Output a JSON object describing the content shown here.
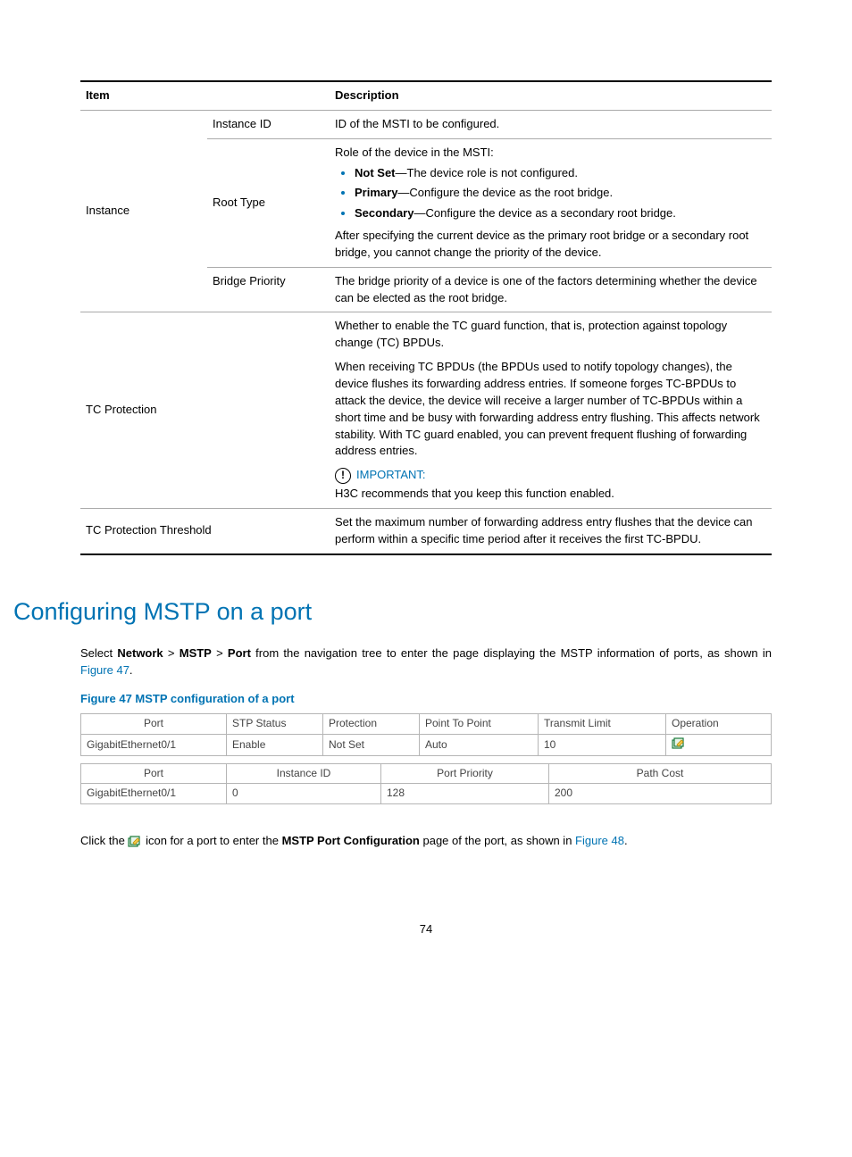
{
  "table": {
    "head_item": "Item",
    "head_desc": "Description",
    "instance_label": "Instance",
    "instance_id_label": "Instance ID",
    "instance_id_desc": "ID of the MSTI to be configured.",
    "root_type_label": "Root Type",
    "root_type_intro": "Role of the device in the MSTI:",
    "root_type_notset_b": "Not Set",
    "root_type_notset": "—The device role is not configured.",
    "root_type_primary_b": "Primary",
    "root_type_primary": "—Configure the device as the root bridge.",
    "root_type_secondary_b": "Secondary",
    "root_type_secondary": "—Configure the device as a secondary root bridge.",
    "root_type_after": "After specifying the current device as the primary root bridge or a secondary root bridge, you cannot change the priority of the device.",
    "bridge_priority_label": "Bridge Priority",
    "bridge_priority_desc": "The bridge priority of a device is one of the factors determining whether the device can be elected as the root bridge.",
    "tc_protection_label": "TC Protection",
    "tc_protection_p1": "Whether to enable the TC guard function, that is, protection against topology change (TC) BPDUs.",
    "tc_protection_p2": "When receiving TC BPDUs (the BPDUs used to notify topology changes), the device flushes its forwarding address entries. If someone forges TC-BPDUs to attack the device, the device will receive a larger number of TC-BPDUs within a short time and be busy with forwarding address entry flushing. This affects network stability. With TC guard enabled, you can prevent frequent flushing of forwarding address entries.",
    "important_label": "IMPORTANT:",
    "tc_protection_p3": "H3C recommends that you keep this function enabled.",
    "tc_threshold_label": "TC Protection Threshold",
    "tc_threshold_desc": "Set the maximum number of forwarding address entry flushes that the device can perform within a specific time period after it receives the first TC-BPDU."
  },
  "section_title": "Configuring MSTP on a port",
  "body_para_1a": "Select ",
  "body_para_1_network": "Network",
  "body_para_1_gt1": " > ",
  "body_para_1_mstp": "MSTP",
  "body_para_1_gt2": " > ",
  "body_para_1_port": "Port",
  "body_para_1b": " from the navigation tree to enter the page displaying the MSTP information of ports, as shown in ",
  "body_para_1_fig": "Figure 47",
  "body_para_1_dot": ".",
  "fig_caption": "Figure 47 MSTP configuration of a port",
  "chart_data": [
    {
      "type": "table",
      "headers": [
        "Port",
        "STP Status",
        "Protection",
        "Point To Point",
        "Transmit Limit",
        "Operation"
      ],
      "rows": [
        [
          "GigabitEthernet0/1",
          "Enable",
          "Not Set",
          "Auto",
          "10",
          "(edit-icon)"
        ]
      ]
    },
    {
      "type": "table",
      "headers": [
        "Port",
        "Instance ID",
        "Port Priority",
        "Path Cost"
      ],
      "rows": [
        [
          "GigabitEthernet0/1",
          "0",
          "128",
          "200"
        ]
      ]
    }
  ],
  "screenshot1": {
    "h_port": "Port",
    "h_stp": "STP Status",
    "h_prot": "Protection",
    "h_p2p": "Point To Point",
    "h_tx": "Transmit Limit",
    "h_op": "Operation",
    "r_port": "GigabitEthernet0/1",
    "r_stp": "Enable",
    "r_prot": "Not Set",
    "r_p2p": "Auto",
    "r_tx": "10"
  },
  "screenshot2": {
    "h_port": "Port",
    "h_inst": "Instance ID",
    "h_pp": "Port Priority",
    "h_pc": "Path Cost",
    "r_port": "GigabitEthernet0/1",
    "r_inst": "0",
    "r_pp": "128",
    "r_pc": "200"
  },
  "body_para_2a": "Click the ",
  "body_para_2b": " icon for a port to enter the ",
  "body_para_2_bold": "MSTP Port Configuration",
  "body_para_2c": " page of the port, as shown in ",
  "body_para_2_fig": "Figure 48",
  "body_para_2_dot": ".",
  "page_num": "74"
}
